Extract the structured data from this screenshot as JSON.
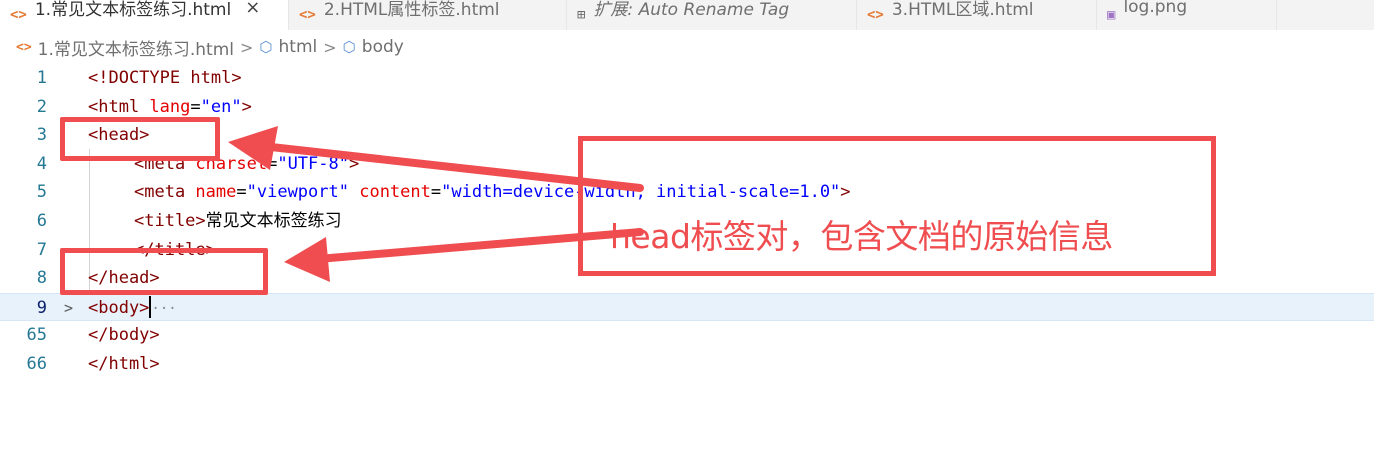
{
  "tabs": [
    {
      "icon": "<>",
      "label": "1.常见文本标签练习.html",
      "close": "×"
    },
    {
      "icon": "<>",
      "label": "2.HTML属性标签.html"
    },
    {
      "icon": "⊞",
      "label": "扩展: Auto Rename Tag"
    },
    {
      "icon": "<>",
      "label": "3.HTML区域.html"
    },
    {
      "icon": "▣",
      "label": "log.png"
    }
  ],
  "breadcrumb": [
    {
      "icon": "<>",
      "label": "1.常见文本标签练习.html"
    },
    {
      "icon": "⬡",
      "label": "html"
    },
    {
      "icon": "⬡",
      "label": "body"
    }
  ],
  "breadcrumb_sep": ">",
  "editor": {
    "lines": [
      {
        "num": "1"
      },
      {
        "num": "2"
      },
      {
        "num": "3"
      },
      {
        "num": "4"
      },
      {
        "num": "5"
      },
      {
        "num": "6"
      },
      {
        "num": "7"
      },
      {
        "num": "8"
      },
      {
        "num": "9"
      },
      {
        "num": "65"
      },
      {
        "num": "66"
      }
    ],
    "code": {
      "l1": {
        "open": "<!DOCTYPE ",
        "kw": "html",
        "close": ">"
      },
      "l2": {
        "open": "<html ",
        "attr": "lang",
        "eq": "=",
        "val": "\"en\"",
        "close": ">"
      },
      "l3": "<head>",
      "l4": {
        "open": "<meta ",
        "attr": "charset",
        "eq": "=",
        "val": "\"UTF-8\"",
        "close": ">"
      },
      "l5": {
        "open": "<meta ",
        "attr1": "name",
        "eq1": "=",
        "val1": "\"viewport\"",
        "attr2": " content",
        "eq2": "=",
        "val2": "\"width=device-width, initial-scale=1.0\"",
        "close": ">"
      },
      "l6": {
        "open": "<title>",
        "text": "常见文本标签练习"
      },
      "l7": "</title>",
      "l8": "</head>",
      "l9": {
        "open": "<body>",
        "dots": "···"
      },
      "l65": "</body>",
      "l66": "</html>"
    },
    "fold_icon": ">"
  },
  "annotation": {
    "text": "head标签对，包含文档的原始信息",
    "color": "#ef4d4f"
  }
}
